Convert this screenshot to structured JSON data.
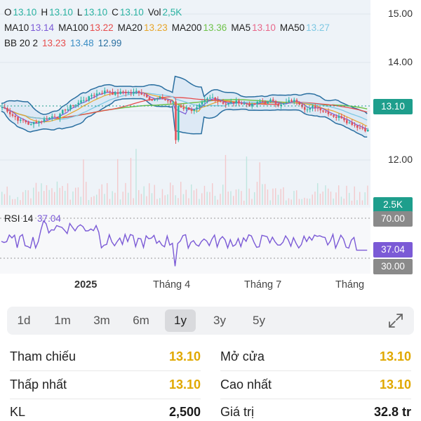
{
  "ohlc": {
    "o_label": "O",
    "o": "13.10",
    "h_label": "H",
    "h": "13.10",
    "l_label": "L",
    "l": "13.10",
    "c_label": "C",
    "c": "13.10",
    "vol_label": "Vol",
    "vol": "2,5K"
  },
  "ma_line": {
    "ma10_label": "MA10",
    "ma10": "13.14",
    "ma100_label": "MA100",
    "ma100": "13.22",
    "ma20_label": "MA20",
    "ma20": "13.23",
    "ma200_label": "MA200",
    "ma200": "13.36",
    "ma5_label": "MA5",
    "ma5": "13.10",
    "ma50_label": "MA50",
    "ma50": "13.27"
  },
  "bb_line": {
    "label": "BB 20 2",
    "upper": "13.23",
    "middle": "13.48",
    "lower": "12.99"
  },
  "price_axis": {
    "p15": "15.00",
    "p14": "14.00",
    "p12": "12.00",
    "last": "13.10"
  },
  "volume_tag": "2.5K",
  "rsi": {
    "label": "RSI 14",
    "value": "37.04",
    "upper": "70.00",
    "lower": "30.00"
  },
  "time_axis": [
    "2025",
    "Tháng 4",
    "Tháng 7",
    "Tháng"
  ],
  "ranges": [
    "1d",
    "1m",
    "3m",
    "6m",
    "1y",
    "3y",
    "5y"
  ],
  "active_range": "1y",
  "stats": {
    "ref_label": "Tham chiếu",
    "ref": "13.10",
    "open_label": "Mở cửa",
    "open": "13.10",
    "low_label": "Thấp nhất",
    "low": "13.10",
    "high_label": "Cao nhất",
    "high": "13.10",
    "kl_label": "KL",
    "kl": "2,500",
    "value_label": "Giá trị",
    "value": "32.8 tr"
  },
  "colors": {
    "up": "#2bb3a2",
    "down": "#e0525a",
    "ma10": "#7b5ad6",
    "ma100": "#e74c4c",
    "ma20": "#e7a52a",
    "ma200": "#6fc24a",
    "ma5": "#e8678a",
    "ma50": "#7ec8e3",
    "bb_upper": "#e74c4c",
    "bb_middle": "#3b8ec4",
    "bb_lower": "#2a6fa0",
    "rsi": "#7b5ad6",
    "accent_yellow": "#e0a800",
    "last_tag": "#1e9e8c",
    "gray_tag": "#8a8a8a"
  }
}
